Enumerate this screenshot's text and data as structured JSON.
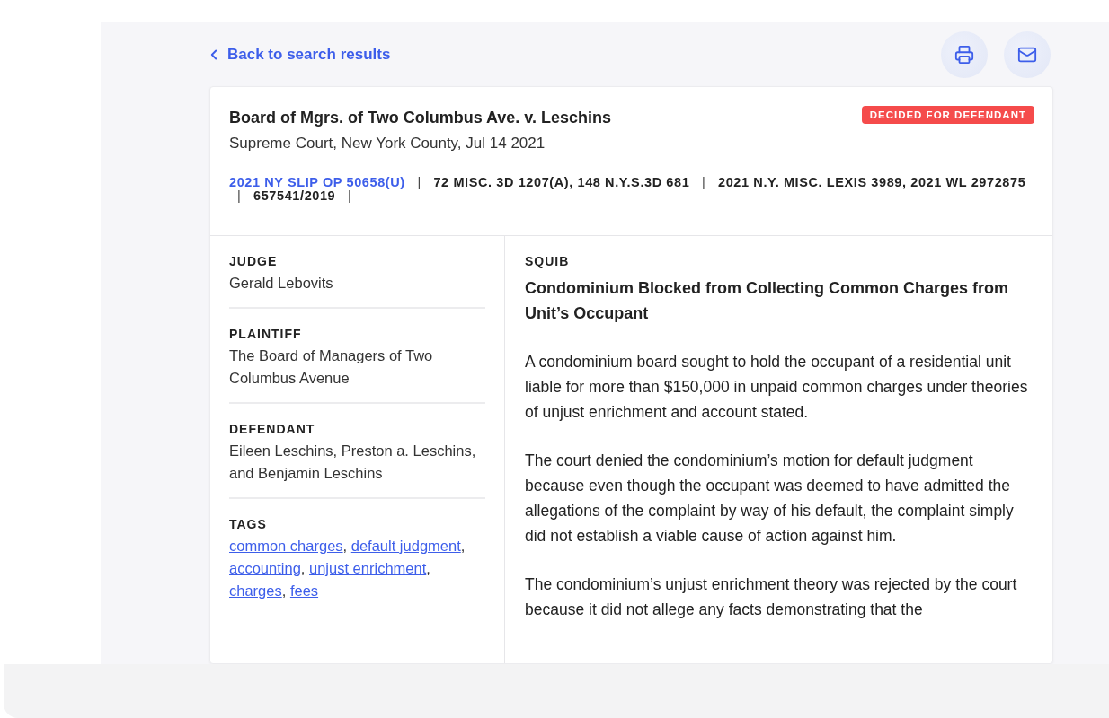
{
  "back_link": {
    "label": "Back to search results"
  },
  "actions": [
    {
      "kind": "print"
    },
    {
      "kind": "mail"
    }
  ],
  "case": {
    "title": "Board of Mgrs. of Two Columbus Ave. v. Leschins",
    "court_date": "Supreme Court, New York County, Jul 14 2021",
    "status_badge": "DECIDED FOR DEFENDANT",
    "citations": [
      {
        "text": "2021 NY SLIP OP 50658(U)",
        "kind": "link"
      },
      {
        "text": "|",
        "kind": "separator"
      },
      {
        "text": "72 MISC. 3D 1207(A), 148 N.Y.S.3D 681",
        "kind": "plain"
      },
      {
        "text": "|",
        "kind": "separator"
      },
      {
        "text": "2021 N.Y. MISC. LEXIS 3989, 2021 WL 2972875",
        "kind": "plain"
      },
      {
        "text": "|",
        "kind": "separator"
      },
      {
        "text": "657541/2019",
        "kind": "plain"
      },
      {
        "text": "|",
        "kind": "separator"
      }
    ]
  },
  "details": [
    {
      "label": "JUDGE",
      "value": "Gerald Lebovits"
    },
    {
      "label": "PLAINTIFF",
      "value": "The Board of Managers of Two Columbus Avenue"
    },
    {
      "label": "DEFENDANT",
      "value": "Eileen Leschins, Preston a. Leschins, and Benjamin Leschins"
    }
  ],
  "tags": {
    "label": "TAGS",
    "items": [
      {
        "label": "common charges",
        "suffix": ","
      },
      {
        "label": "default judgment",
        "suffix": ","
      },
      {
        "label": "accounting",
        "suffix": ","
      },
      {
        "label": "unjust enrichment",
        "suffix": ","
      },
      {
        "label": "charges",
        "suffix": ","
      },
      {
        "label": "fees"
      }
    ]
  },
  "squib": {
    "label": "SQUIB",
    "heading": "Condominium Blocked from Collecting Common Charges from Unit’s Occupant",
    "paragraphs": [
      "A condominium board sought to hold the occupant of a residential unit liable for more than $150,000 in unpaid common charges under theories of unjust enrichment and account stated.",
      "The court denied the condominium’s motion for default judgment because even though the occupant was deemed to have admitted the allegations of the complaint by way of his default, the complaint simply did not establish a viable cause of action against him.",
      "The condominium’s unjust enrichment theory was rejected by the court because it did not allege any facts demonstrating that the"
    ]
  }
}
